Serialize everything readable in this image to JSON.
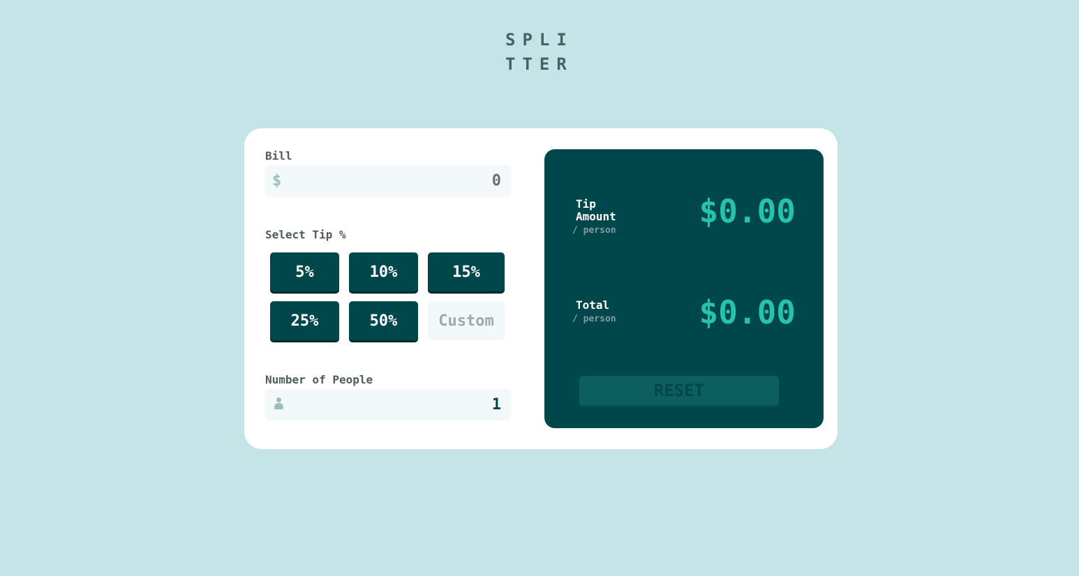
{
  "logo": {
    "line1": "SPLI",
    "line2": "TTER"
  },
  "bill": {
    "label": "Bill",
    "currency_symbol": "$",
    "value": "0"
  },
  "tip": {
    "label": "Select Tip %",
    "options": [
      "5%",
      "10%",
      "15%",
      "25%",
      "50%"
    ],
    "custom_placeholder": "Custom"
  },
  "people": {
    "label": "Number of People",
    "value": "1",
    "icon": "person-icon"
  },
  "results": {
    "tip_amount": {
      "label_line1": "Tip",
      "label_line2": "Amount",
      "sub": "/ person",
      "value": "$0.00"
    },
    "total": {
      "label": "Total",
      "sub": "/ person",
      "value": "$0.00"
    },
    "reset_label": "RESET"
  },
  "colors": {
    "background": "#c5e4e7",
    "panel": "#00474b",
    "accent": "#26c2ad",
    "card": "#ffffff"
  }
}
